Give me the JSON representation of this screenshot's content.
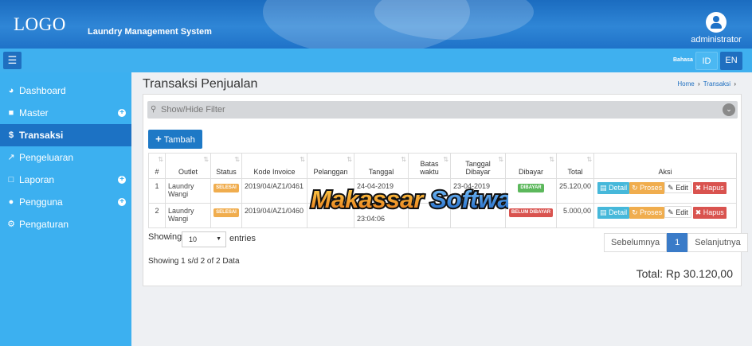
{
  "header": {
    "logo": "LOGO",
    "app_title": "Laundry Management System",
    "user_name": "administrator"
  },
  "subbar": {
    "menu_icon": "hamburger-icon",
    "lang_label": "Bahasa",
    "lang_id": "ID",
    "lang_en": "EN"
  },
  "sidebar": {
    "items": [
      {
        "label": "Dashboard",
        "icon": "dashboard-icon"
      },
      {
        "label": "Master",
        "icon": "book-icon"
      },
      {
        "label": "Transaksi",
        "icon": "dollar-icon"
      },
      {
        "label": "Pengeluaran",
        "icon": "external-link-icon"
      },
      {
        "label": "Laporan",
        "icon": "file-icon"
      },
      {
        "label": "Pengguna",
        "icon": "user-icon"
      },
      {
        "label": "Pengaturan",
        "icon": "gear-icon"
      }
    ]
  },
  "main": {
    "title": "Transaksi Penjualan",
    "breadcrumb": {
      "home": "Home",
      "current": "Transaksi"
    },
    "filter_label": "Show/Hide Filter",
    "add_button": "Tambah",
    "table": {
      "headers": [
        "#",
        "Outlet",
        "Status",
        "Kode Invoice",
        "Pelanggan",
        "Tanggal",
        "Batas waktu",
        "Tanggal Dibayar",
        "Dibayar",
        "Total",
        "Aksi"
      ],
      "rows": [
        {
          "no": "1",
          "outlet": "Laundry Wangi",
          "status": "SELESAI",
          "invoice": "2019/04/AZ1/0461",
          "pelanggan": "",
          "tanggal": "24-04-2019",
          "batas": "",
          "tgl_bayar": "23-04-2019",
          "dibayar": "DIBAYAR",
          "total": "25.120,00"
        },
        {
          "no": "2",
          "outlet": "Laundry Wangi",
          "status": "SELESAI",
          "invoice": "2019/04/AZ1/0460",
          "pelanggan": "",
          "tanggal": "23:04:06",
          "batas": "",
          "tgl_bayar": "",
          "dibayar": "BELUM DIBAYAR",
          "total": "5.000,00"
        }
      ],
      "actions": {
        "detail": "Detail",
        "proses": "Proses",
        "edit": "Edit",
        "hapus": "Hapus"
      }
    },
    "length": {
      "showing": "Showing",
      "value": "10",
      "entries": "entries"
    },
    "info": "Showing 1 s/d 2 of 2 Data",
    "pager": {
      "prev": "Sebelumnya",
      "page": "1",
      "next": "Selanjutnya"
    },
    "total": "Total: Rp 30.120,00",
    "watermark": "Makassar Software"
  },
  "colors": {
    "header": "#1f72c8",
    "sidebar": "#3cb0f0",
    "active": "#1c72c4",
    "primary_button": "#1e79c6"
  }
}
